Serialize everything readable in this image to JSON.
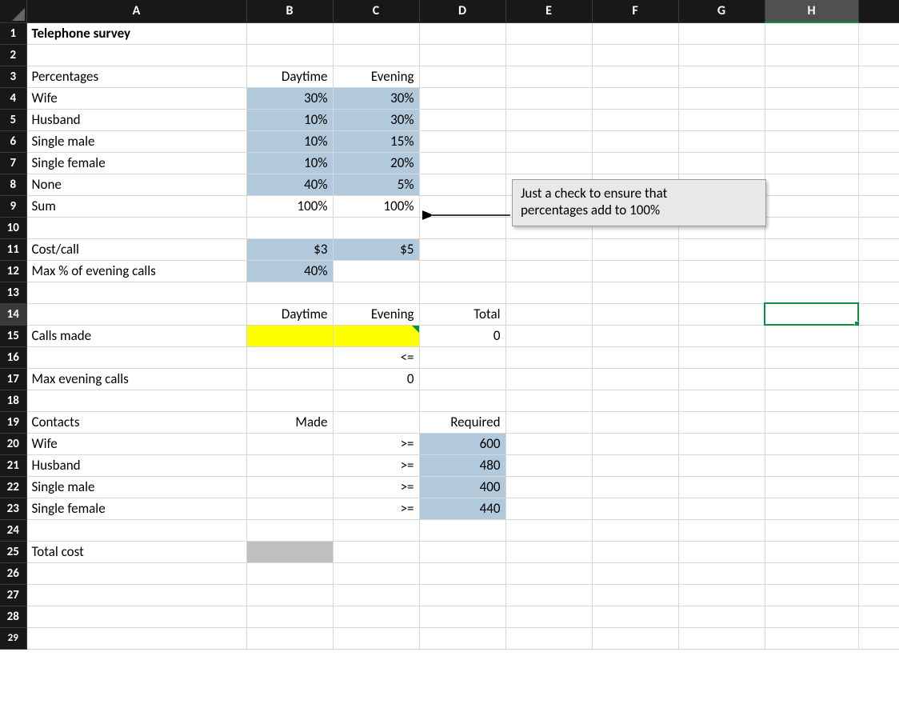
{
  "columns": [
    "A",
    "B",
    "C",
    "D",
    "E",
    "F",
    "G",
    "H"
  ],
  "selectedColumn": "H",
  "selectedCell": "H14",
  "rowCount": 29,
  "title": "Telephone survey",
  "percentagesHeader": {
    "label": "Percentages",
    "colB": "Daytime",
    "colC": "Evening"
  },
  "percentRows": [
    {
      "label": "Wife",
      "day": "30%",
      "eve": "30%"
    },
    {
      "label": "Husband",
      "day": "10%",
      "eve": "30%"
    },
    {
      "label": "Single male",
      "day": "10%",
      "eve": "15%"
    },
    {
      "label": "Single female",
      "day": "10%",
      "eve": "20%"
    },
    {
      "label": "None",
      "day": "40%",
      "eve": "5%"
    }
  ],
  "sumRow": {
    "label": "Sum",
    "day": "100%",
    "eve": "100%"
  },
  "costRow": {
    "label": "Cost/call",
    "day": "$3",
    "eve": "$5"
  },
  "maxEvePctRow": {
    "label": "Max % of evening calls",
    "day": "40%"
  },
  "callsHeader": {
    "colB": "Daytime",
    "colC": "Evening",
    "colD": "Total"
  },
  "callsMade": {
    "label": "Calls made",
    "total": "0"
  },
  "leqRow": {
    "c": "<="
  },
  "maxEveCalls": {
    "label": "Max evening calls",
    "c": "0"
  },
  "contactsHeader": {
    "label": "Contacts",
    "colB": "Made",
    "colD": "Required"
  },
  "contactRows": [
    {
      "label": "Wife",
      "op": ">=",
      "req": "600"
    },
    {
      "label": "Husband",
      "op": ">=",
      "req": "480"
    },
    {
      "label": "Single male",
      "op": ">=",
      "req": "400"
    },
    {
      "label": "Single female",
      "op": ">=",
      "req": "440"
    }
  ],
  "totalCost": {
    "label": "Total cost"
  },
  "callout": {
    "line1": "Just a check to ensure that",
    "line2": "percentages add to 100%"
  }
}
